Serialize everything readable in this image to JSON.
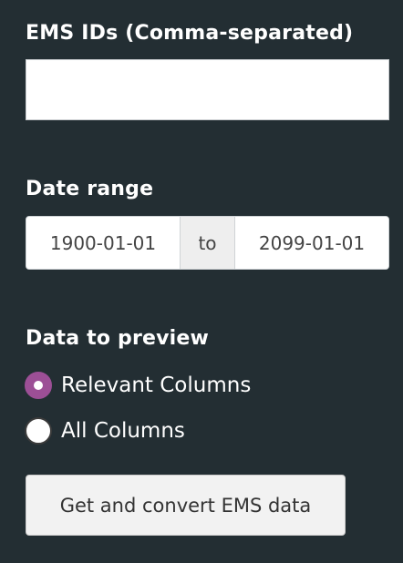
{
  "ems_ids": {
    "label": "EMS IDs (Comma-separated)",
    "value": "",
    "placeholder": ""
  },
  "date_range": {
    "label": "Date range",
    "start": "1900-01-01",
    "separator": "to",
    "end": "2099-01-01"
  },
  "preview": {
    "label": "Data to preview",
    "options": [
      {
        "label": "Relevant Columns",
        "selected": true
      },
      {
        "label": "All Columns",
        "selected": false
      }
    ],
    "accent_color": "#9c4f96"
  },
  "action": {
    "label": "Get and convert EMS data"
  },
  "theme": {
    "background": "#232e33"
  }
}
